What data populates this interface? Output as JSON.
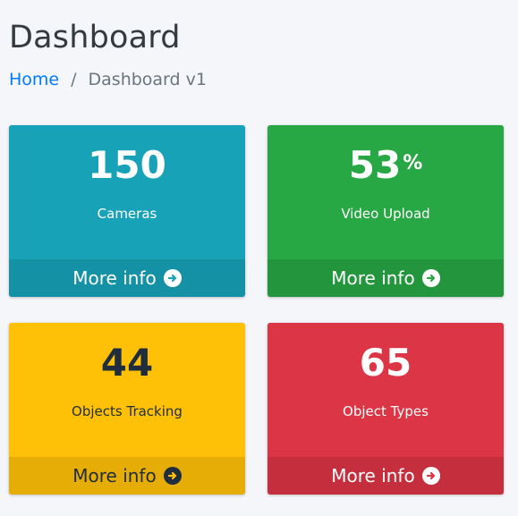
{
  "header": {
    "title": "Dashboard",
    "breadcrumb": {
      "home": "Home",
      "separator": "/",
      "current": "Dashboard v1"
    }
  },
  "boxes": [
    {
      "value": "150",
      "suffix": "",
      "label": "Cameras",
      "link": "More info",
      "color": "#17a2b8"
    },
    {
      "value": "53",
      "suffix": "%",
      "label": "Video Upload",
      "link": "More info",
      "color": "#28a745"
    },
    {
      "value": "44",
      "suffix": "",
      "label": "Objects Tracking",
      "link": "More info",
      "color": "#ffc107"
    },
    {
      "value": "65",
      "suffix": "",
      "label": "Object Types",
      "link": "More info",
      "color": "#dc3545"
    }
  ],
  "colors": {
    "link": "#007bff",
    "background": "#f4f6f9"
  },
  "icons": {
    "more_info": "arrow-circle-right-icon"
  }
}
